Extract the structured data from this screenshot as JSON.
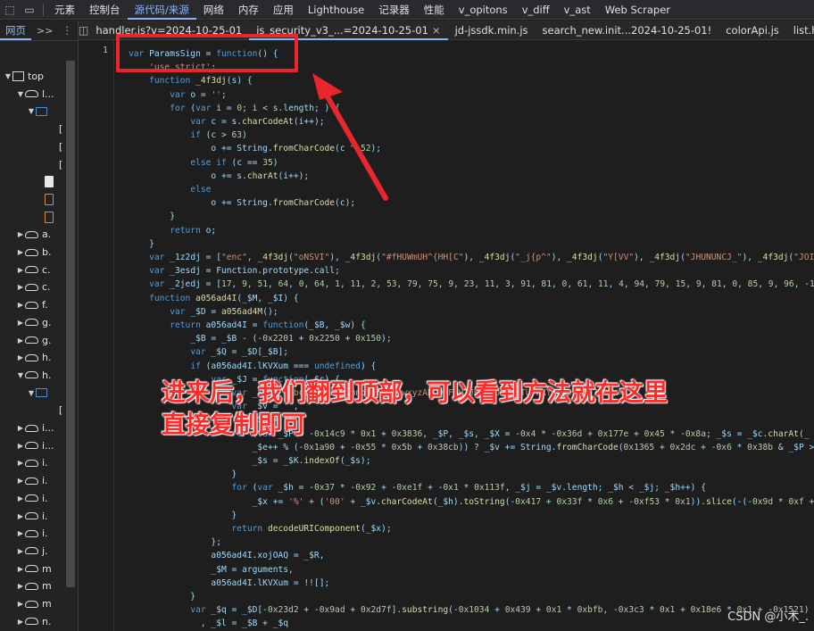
{
  "toolbar": {
    "tabs": [
      "元素",
      "控制台",
      "源代码/来源",
      "网络",
      "内存",
      "应用",
      "Lighthouse",
      "记录器",
      "性能",
      "v_opitons",
      "v_diff",
      "v_ast",
      "Web Scraper"
    ],
    "active_tab": "源代码/来源"
  },
  "navigator": {
    "tab": "网页",
    "more": ">>",
    "items": [
      {
        "label": "top",
        "icon": "frame-icon"
      },
      {
        "label": "l...",
        "icon": "cloud-icon"
      },
      {
        "label": "",
        "icon": "folder-icon"
      },
      {
        "label": "[",
        "icon": "bracket-icon"
      },
      {
        "label": "[",
        "icon": "bracket-icon"
      },
      {
        "label": "[",
        "icon": "bracket-icon"
      },
      {
        "label": "",
        "icon": "file-icon"
      },
      {
        "label": "",
        "icon": "file-orange-icon"
      },
      {
        "label": "",
        "icon": "file-orange-icon"
      },
      {
        "label": "a.",
        "icon": "cloud-icon"
      },
      {
        "label": "b.",
        "icon": "cloud-icon"
      },
      {
        "label": "c.",
        "icon": "cloud-icon"
      },
      {
        "label": "c.",
        "icon": "cloud-icon"
      },
      {
        "label": "f.",
        "icon": "cloud-icon"
      },
      {
        "label": "g.",
        "icon": "cloud-icon"
      },
      {
        "label": "g.",
        "icon": "cloud-icon"
      },
      {
        "label": "h.",
        "icon": "cloud-icon"
      },
      {
        "label": "h.",
        "icon": "cloud-icon"
      },
      {
        "label": "",
        "icon": "folder-icon"
      },
      {
        "label": "[",
        "icon": "bracket-icon"
      },
      {
        "label": "i...",
        "icon": "cloud-icon"
      },
      {
        "label": "i...",
        "icon": "cloud-icon"
      },
      {
        "label": "i.",
        "icon": "cloud-icon"
      },
      {
        "label": "i.",
        "icon": "cloud-icon"
      },
      {
        "label": "i.",
        "icon": "cloud-icon"
      },
      {
        "label": "i.",
        "icon": "cloud-icon"
      },
      {
        "label": "i.",
        "icon": "cloud-icon"
      },
      {
        "label": "j.",
        "icon": "cloud-icon"
      },
      {
        "label": "m",
        "icon": "cloud-icon"
      },
      {
        "label": "m",
        "icon": "cloud-icon"
      },
      {
        "label": "m",
        "icon": "cloud-icon"
      },
      {
        "label": "n.",
        "icon": "cloud-icon"
      }
    ]
  },
  "editor": {
    "tabs": [
      {
        "label": "handler.js?v=2024-10-25-01",
        "active": false
      },
      {
        "label": "js_security_v3_...=2024-10-25-01",
        "active": true
      },
      {
        "label": "jd-jssdk.min.js",
        "active": false
      },
      {
        "label": "search_new.init...2024-10-25-01!",
        "active": false
      },
      {
        "label": "colorApi.js",
        "active": false
      },
      {
        "label": "list.h",
        "active": false
      }
    ],
    "line_number": "1",
    "code_lines": [
      "var ParamsSign = function() {",
      "    'use strict';",
      "    function _4f3dj(s) {",
      "        var o = '';",
      "        for (var i = 0; i < s.length; ) {",
      "            var c = s.charCodeAt(i++);",
      "            if (c > 63)",
      "                o += String.fromCharCode(c ^ 52);",
      "            else if (c == 35)",
      "                o += s.charAt(i++);",
      "            else",
      "                o += String.fromCharCode(c);",
      "        }",
      "        return o;",
      "    }",
      "    var _1z2dj = [\"enc\", _4f3dj(\"oNSVI\"), _4f3dj(\"#fHUWmUH^{HH[C\"), _4f3dj(\"_j{p^\"), _4f3dj(\"Y[VV\"), _4f3dj(\"JHUNUNCJ_\"), _4f3dj(\"JOIR\"), _4f3",
      "    var _3esdj = Function.prototype.call;",
      "    var _2jedj = [17, 9, 51, 64, 0, 64, 1, 11, 2, 53, 79, 75, 9, 23, 11, 3, 91, 81, 0, 61, 11, 4, 94, 79, 15, 9, 81, 0, 85, 9, 96, -1644, 96,",
      "    function a056ad4I(_$M, _$I) {",
      "        var _$D = a056ad4M();",
      "        return a056ad4I = function(_$B, _$w) {",
      "            _$B = _$B - (-0x2201 + 0x2250 + 0x150);",
      "            var _$Q = _$D[_$B];",
      "            if (a056ad4I.lKVXum === undefined) {",
      "                var _$J = function(_$c) {",
      "                    var _$K = 'abcdefghijklmnopqrstuvwxyzABCDEFGHIJKLMNOPQRSTUVWXYZ0123456789+/=';",
      "                    var _$v = '',",
      "                        _$x = '';",
      "                    for (var _$P = -0x14c9 * 0x1 + 0x3836, _$P, _$s, _$X = -0x4 * -0x36d + 0x177e + 0x45 * -0x8a; _$s = _$c.charAt(_",
      "                        _$e++ % (-0x1a90 + -0x55 * 0x5b + 0x38cb)) ? _$v += String.fromCharCode(0x1365 + 0x2dc + -0x6 * 0x38b & _$P >> (-(0x1140 +",
      "                        _$s = _$K.indexOf(_$s);",
      "                    }",
      "                    for (var _$h = -0x37 * -0x92 + -0xe1f + -0x1 * 0x113f, _$j = _$v.length; _$h < _$j; _$h++) {",
      "                        _$x += '%' + ('00' + _$v.charCodeAt(_$h).toString(-0x417 + 0x33f * 0x6 + -0xf53 * 0x1)).slice(-(-0x9d * 0xf + 0x1b23 +",
      "                    }",
      "                    return decodeURIComponent(_$x);",
      "                };",
      "                a056ad4I.xojOAQ = _$R,",
      "                _$M = arguments,",
      "                a056ad4I.lKVXum = !![];",
      "            }",
      "            var _$q = _$D[-0x23d2 + -0x9ad + 0x2d7f].substring(-0x1034 + 0x439 + 0x1 * 0xbfb, -0x3c3 * 0x1 + 0x18e6 * 0x1 + -0x1521)",
      "              , _$l = _$B + _$q",
      "              , _$Q = _$D[_$l];"
    ]
  },
  "annotation": {
    "line1": "进来后，我们翻到顶部，可以看到方法就在这里",
    "line2": "直接复制即可",
    "color": "#ff2a2a"
  },
  "watermark": "CSDN @小木_."
}
